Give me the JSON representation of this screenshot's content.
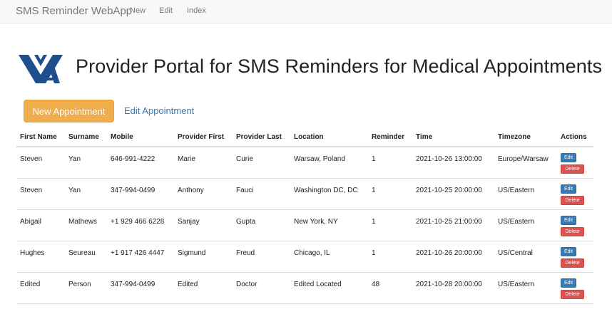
{
  "navbar": {
    "brand": "SMS Reminder WebApp",
    "links": [
      "New",
      "Edit",
      "Index"
    ]
  },
  "header": {
    "title": "Provider Portal for SMS Reminders for Medical Appointments",
    "logo_color": "#1f4e8c"
  },
  "toolbar": {
    "new_label": "New Appointment",
    "edit_label": "Edit Appointment"
  },
  "table": {
    "headers": [
      "First Name",
      "Surname",
      "Mobile",
      "Provider First",
      "Provider Last",
      "Location",
      "Reminder",
      "Time",
      "Timezone",
      "Actions"
    ],
    "rows": [
      {
        "first": "Steven",
        "surname": "Yan",
        "mobile": "646-991-4222",
        "provider_first": "Marie",
        "provider_last": "Curie",
        "location": "Warsaw, Poland",
        "reminder": "1",
        "time": "2021-10-26 13:00:00",
        "timezone": "Europe/Warsaw"
      },
      {
        "first": "Steven",
        "surname": "Yan",
        "mobile": "347-994-0499",
        "provider_first": "Anthony",
        "provider_last": "Fauci",
        "location": "Washington DC, DC",
        "reminder": "1",
        "time": "2021-10-25 20:00:00",
        "timezone": "US/Eastern"
      },
      {
        "first": "Abigail",
        "surname": "Mathews",
        "mobile": "+1 929 466 6228",
        "provider_first": "Sanjay",
        "provider_last": "Gupta",
        "location": "New York, NY",
        "reminder": "1",
        "time": "2021-10-25 21:00:00",
        "timezone": "US/Eastern"
      },
      {
        "first": "Hughes",
        "surname": "Seureau",
        "mobile": "+1 917 426 4447",
        "provider_first": "Sigmund",
        "provider_last": "Freud",
        "location": "Chicago, IL",
        "reminder": "1",
        "time": "2021-10-26 20:00:00",
        "timezone": "US/Central"
      },
      {
        "first": "Edited",
        "surname": "Person",
        "mobile": "347-994-0499",
        "provider_first": "Edited",
        "provider_last": "Doctor",
        "location": "Edited Located",
        "reminder": "48",
        "time": "2021-10-28 20:00:00",
        "timezone": "US/Eastern"
      }
    ],
    "edit_label": "Edit",
    "delete_label": "Delete"
  },
  "colors": {
    "warning": "#f0ad4e",
    "primary": "#337ab7",
    "danger": "#d9534f",
    "navbar_bg": "#f8f8f8"
  }
}
